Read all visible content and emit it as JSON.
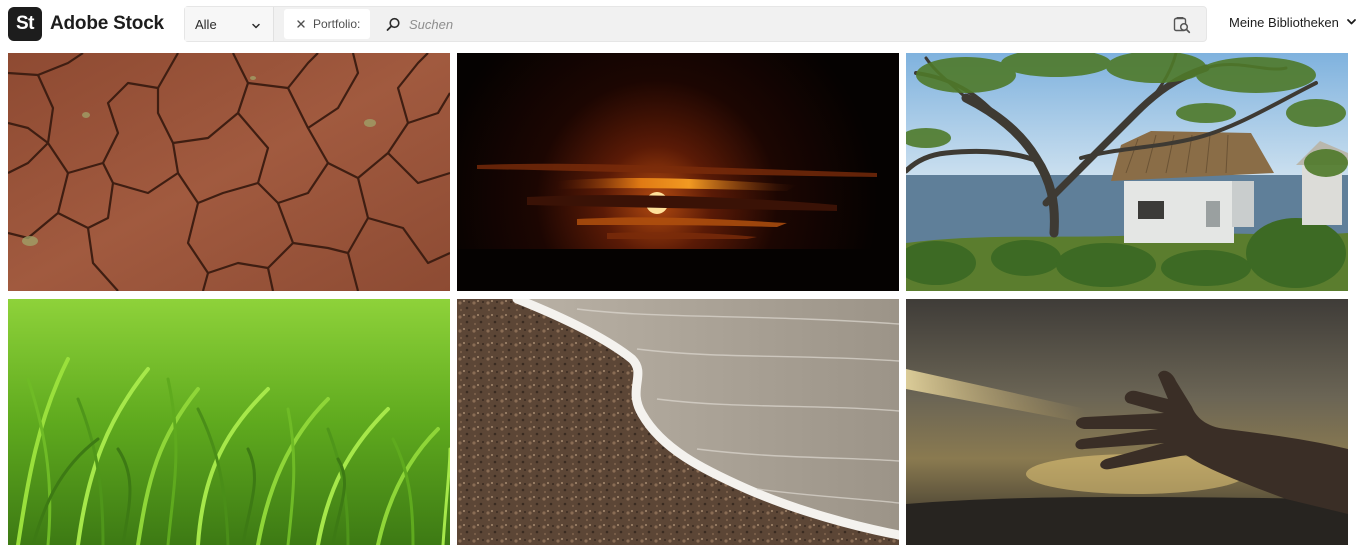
{
  "header": {
    "logo_badge": "St",
    "logo_text": "Adobe Stock",
    "type_select": {
      "value": "Alle"
    },
    "filter_chip": {
      "label": "Portfolio:"
    },
    "search": {
      "placeholder": "Suchen",
      "value": ""
    },
    "libraries_label": "Meine Bibliotheken"
  },
  "icons": {
    "type_chevron": "chevron-down-icon",
    "chip_close": "close-icon",
    "search": "search-icon",
    "visual_search": "visual-search-icon",
    "libraries_chevron": "chevron-down-icon"
  },
  "colors": {
    "logo_badge": "#1d1d1d",
    "search_bar_bg": "#f1f1f1"
  },
  "images": [
    {
      "subject": "cracked-earth"
    },
    {
      "subject": "sunset"
    },
    {
      "subject": "tree-and-house-by-sea"
    },
    {
      "subject": "green-grass"
    },
    {
      "subject": "beach-wave"
    },
    {
      "subject": "hand-in-sunlight"
    }
  ]
}
